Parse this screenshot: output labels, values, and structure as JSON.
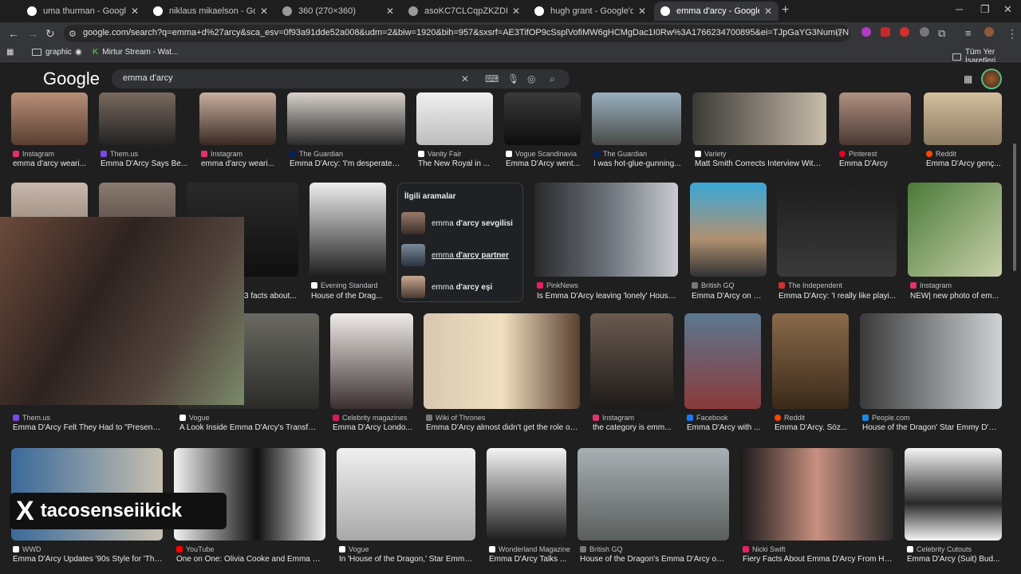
{
  "browser": {
    "tabs": [
      {
        "title": "uma thurman - Google'da Ara",
        "active": false
      },
      {
        "title": "niklaus mikaelson - Google'da A",
        "active": false
      },
      {
        "title": "360 (270×360)",
        "active": false
      },
      {
        "title": "asoKC7CLCqpZKZDL6iovNurCU",
        "active": false
      },
      {
        "title": "hugh grant - Google'da Ara",
        "active": false
      },
      {
        "title": "emma d'arcy - Google'da Ara",
        "active": true
      }
    ],
    "url": "google.com/search?q=emma+d%27arcy&sca_esv=0f93a91dde52a008&udm=2&biw=1920&bih=957&sxsrf=AE3TifOP9cSsplVofiMW6gHCMgDac1I0Rw%3A1766234700895&ei=TJpGaYG3NumI7NYPkJ3nqAE&oq=emma+dar...",
    "bookmarks": [
      "graphic",
      "Mirtur Stream - Wat..."
    ],
    "other_bookmarks": "Tüm Yer İşaretleri"
  },
  "google": {
    "logo": "Google",
    "query": "emma d'arcy"
  },
  "related": {
    "heading": "İlgili aramalar",
    "items": [
      {
        "pre": "emma ",
        "bold": "d'arcy sevgilisi"
      },
      {
        "pre": "emma ",
        "bold": "d'arcy partner"
      },
      {
        "pre": "emma ",
        "bold": "d'arcy eşi"
      }
    ]
  },
  "results_row1": [
    {
      "source": "Instagram",
      "caption": "emma d'arcy weari..."
    },
    {
      "source": "Them.us",
      "caption": "Emma D'Arcy Says Be..."
    },
    {
      "source": "Instagram",
      "caption": "emma d'arcy weari..."
    },
    {
      "source": "The Guardian",
      "caption": "Emma D'Arcy: 'I'm desperate f..."
    },
    {
      "source": "Vanity Fair",
      "caption": "The New Royal in ..."
    },
    {
      "source": "Vogue Scandinavia",
      "caption": "Emma D'Arcy went..."
    },
    {
      "source": "The Guardian",
      "caption": "I was hot-glue-gunning..."
    },
    {
      "source": "Variety",
      "caption": "Matt Smith Corrects Interview With ..."
    },
    {
      "source": "Pinterest",
      "caption": "Emma D'Arcy"
    },
    {
      "source": "Reddit",
      "caption": "Emma D'Arcy genç..."
    }
  ],
  "results_row2": [
    {
      "source": "",
      "caption": "3 facts about..."
    },
    {
      "source": "Evening Standard",
      "caption": "House of the Drag..."
    },
    {
      "source": "PinkNews",
      "caption": "Is Emma D'Arcy leaving 'lonely' House..."
    },
    {
      "source": "British GQ",
      "caption": "Emma D'Arcy on H..."
    },
    {
      "source": "The Independent",
      "caption": "Emma D'Arcy: 'I really like playi..."
    },
    {
      "source": "Instagram",
      "caption": "NEW| new photo of em..."
    }
  ],
  "results_row3": [
    {
      "source": "Them.us",
      "caption": "Emma D'Arcy Felt They Had to \"Present a..."
    },
    {
      "source": "Vogue",
      "caption": "A Look Inside Emma D'Arcy's Transfo..."
    },
    {
      "source": "Celebrity magazines",
      "caption": "Emma D'Arcy Londo..."
    },
    {
      "source": "Wiki of Thrones",
      "caption": "Emma D'Arcy almost didn't get the role of ..."
    },
    {
      "source": "Instagram",
      "caption": "the category is emm..."
    },
    {
      "source": "Facebook",
      "caption": "Emma D'Arcy with ..."
    },
    {
      "source": "Reddit",
      "caption": "Emma D'Arcy. Söz..."
    },
    {
      "source": "People.com",
      "caption": "House of the Dragon' Star Emmy D'Ar..."
    }
  ],
  "results_row4": [
    {
      "source": "WWD",
      "caption": "Emma D'Arcy Updates '90s Style for 'The..."
    },
    {
      "source": "YouTube",
      "caption": "One on One: Olivia Cooke and Emma D'..."
    },
    {
      "source": "Vogue",
      "caption": "In 'House of the Dragon,' Star Emma ..."
    },
    {
      "source": "Wonderland Magazine",
      "caption": "Emma D'Arcy Talks ..."
    },
    {
      "source": "British GQ",
      "caption": "House of the Dragon's Emma D'Arcy on ..."
    },
    {
      "source": "Nicki Swift",
      "caption": "Fiery Facts About Emma D'Arcy From Ho..."
    },
    {
      "source": "Celebrity Cutouts",
      "caption": "Emma D'Arcy (Suit) Bud..."
    }
  ],
  "overlay": {
    "handle": "tacosenseiikick",
    "x_logo": "X"
  },
  "colors": {
    "accent": "#8ab4f8",
    "bg": "#1f1f1f"
  }
}
